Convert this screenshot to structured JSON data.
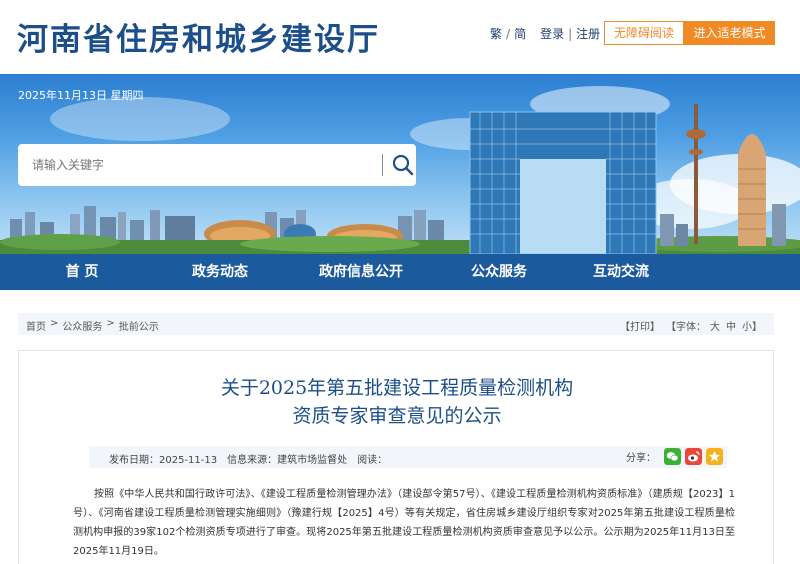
{
  "header": {
    "site_title": "河南省住房和城乡建设厅",
    "lang_trad": "繁",
    "lang_simp": "简",
    "login": "登录",
    "register": "注册",
    "accessibility_btn": "无障碍阅读",
    "elder_mode_btn": "进入适老模式",
    "accent_color": "#f08a24"
  },
  "banner": {
    "date": "2025年11月13日 星期四",
    "search_placeholder": "请输入关键字"
  },
  "nav": {
    "items": [
      {
        "label": "首  页"
      },
      {
        "label": "政务动态"
      },
      {
        "label": "政府信息公开"
      },
      {
        "label": "公众服务"
      },
      {
        "label": "互动交流"
      }
    ],
    "color": "#1b5a9c"
  },
  "breadcrumb": {
    "items": [
      "首页",
      "公众服务",
      "批前公示"
    ],
    "print": "【打印】",
    "font_size_label": "【字体：",
    "size_large": "大",
    "size_medium": "中",
    "size_small": "小",
    "font_size_end": "】"
  },
  "article": {
    "title_line1": "关于2025年第五批建设工程质量检测机构",
    "title_line2": "资质专家审查意见的公示",
    "publish_date": "发布日期：2025-11-13",
    "source": "信息来源：建筑市场监督处",
    "reads": "阅读：",
    "share_label": "分享：",
    "share_icons": [
      "wechat-icon",
      "weibo-icon",
      "favorite-icon"
    ],
    "body": "按照《中华人民共和国行政许可法》、《建设工程质量检测管理办法》（建设部令第57号）、《建设工程质量检测机构资质标准》（建质规【2023】1号）、《河南省建设工程质量检测管理实施细则》（豫建行规【2025】4号）等有关规定，省住房城乡建设厅组织专家对2025年第五批建设工程质量检测机构申报的39家102个检测资质专项进行了审查。现将2025年第五批建设工程质量检测机构资质审查意见予以公示。公示期为2025年11月13日至2025年11月19日。"
  }
}
